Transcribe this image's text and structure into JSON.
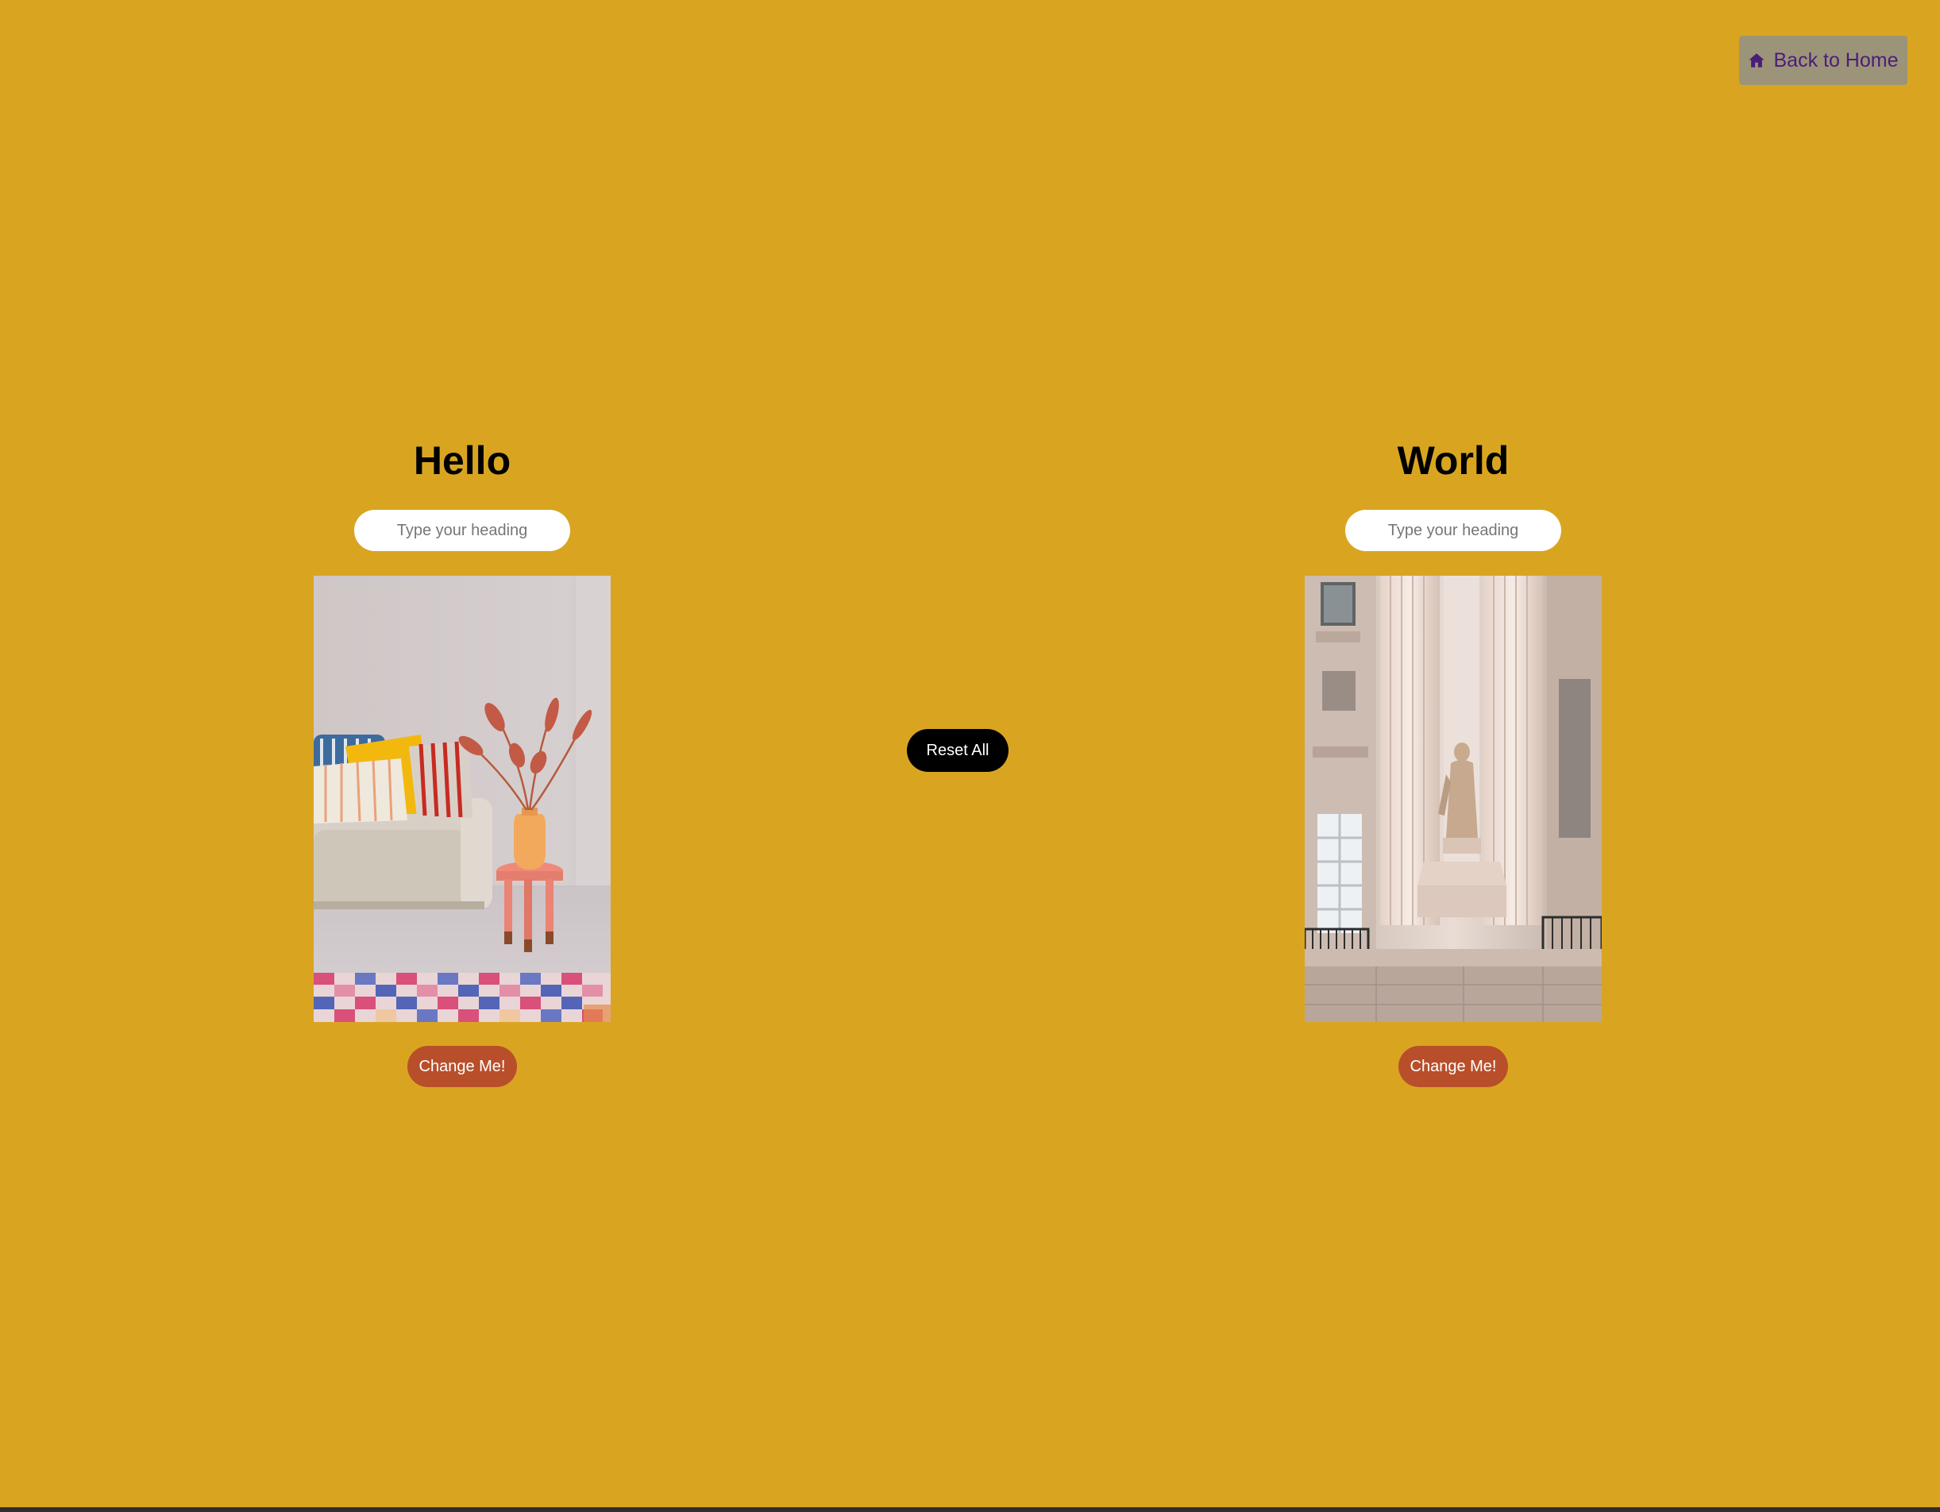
{
  "nav": {
    "home_label": "Back to Home",
    "home_icon": "home-icon",
    "home_color": "#4b1d7a"
  },
  "theme": {
    "background": "#d9a521",
    "change_button_color": "#b84f2a",
    "reset_button_color": "#000000"
  },
  "left_panel": {
    "heading": "Hello",
    "input_placeholder": "Type your heading",
    "input_value": "",
    "button_label": "Change Me!"
  },
  "right_panel": {
    "heading": "World",
    "input_placeholder": "Type your heading",
    "input_value": "",
    "button_label": "Change Me!"
  },
  "reset_label": "Reset All"
}
